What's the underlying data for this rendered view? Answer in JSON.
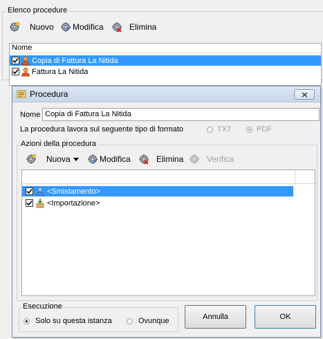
{
  "main": {
    "group_title": "Elenco procedure",
    "toolbar": {
      "new_label": "Nuovo",
      "edit_label": "Modifica",
      "delete_label": "Elimina"
    },
    "list": {
      "header": "Nome",
      "items": [
        {
          "label": "Copia di Fattura La Nitida",
          "checked": true,
          "selected": true
        },
        {
          "label": "Fattura La Nitida",
          "checked": true,
          "selected": false
        }
      ]
    }
  },
  "dialog": {
    "title": "Procedura",
    "name_label": "Nome",
    "name_value": "Copia di Fattura La Nitida",
    "format_label": "La procedura lavora sul seguente tipo di formato",
    "format_options": [
      {
        "label": "TXT",
        "selected": false
      },
      {
        "label": "PDF",
        "selected": true
      }
    ],
    "actions": {
      "group_title": "Azioni della procedura",
      "toolbar": {
        "new_label": "Nuova",
        "edit_label": "Modifica",
        "delete_label": "Elimina",
        "verify_label": "Verifica"
      },
      "items": [
        {
          "label": "<Smistamento>",
          "checked": true,
          "selected": true
        },
        {
          "label": "<Importazione>",
          "checked": true,
          "selected": false
        }
      ]
    },
    "execution": {
      "group_title": "Esecuzione",
      "options": [
        {
          "label": "Solo su questa istanza",
          "selected": true
        },
        {
          "label": "Ovunque",
          "selected": false
        }
      ]
    },
    "buttons": {
      "cancel_label": "Annulla",
      "ok_label": "OK"
    }
  }
}
